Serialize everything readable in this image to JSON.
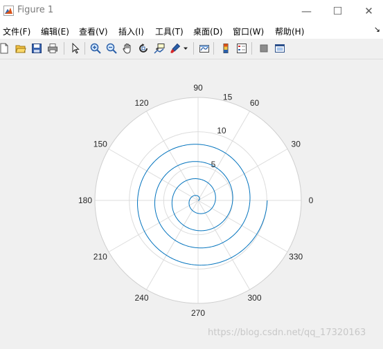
{
  "window": {
    "title": "Figure 1",
    "controls": {
      "minimize": "—",
      "maximize": "☐",
      "close": "✕"
    }
  },
  "menu": [
    "文件(F)",
    "编辑(E)",
    "查看(V)",
    "插入(I)",
    "工具(T)",
    "桌面(D)",
    "窗口(W)",
    "帮助(H)"
  ],
  "menu_overflow": "↘",
  "toolbar": [
    "new-figure-icon",
    "open-file-icon",
    "save-icon",
    "print-icon",
    "select-pointer-icon",
    "zoom-in-icon",
    "zoom-out-icon",
    "pan-hand-icon",
    "rotate-3d-icon",
    "data-cursor-icon",
    "brush-icon",
    "link-plot-icon",
    "colorbar-icon",
    "legend-icon",
    "hide-plot-tools-icon",
    "show-plot-tools-icon"
  ],
  "chart_data": {
    "type": "line",
    "subtype": "polar",
    "theta_tick_labels": [
      "0",
      "30",
      "60",
      "90",
      "120",
      "150",
      "180",
      "210",
      "240",
      "270",
      "300",
      "330"
    ],
    "r_tick_labels": [
      "5",
      "10",
      "15"
    ],
    "rlim": [
      0,
      15
    ],
    "grid": true,
    "series": [
      {
        "color": "#0072bd",
        "r_equals_theta_radians_times": 0.4,
        "theta_range_deg": [
          0,
          1440
        ]
      }
    ]
  },
  "watermark": "https://blog.csdn.net/qq_17320163"
}
